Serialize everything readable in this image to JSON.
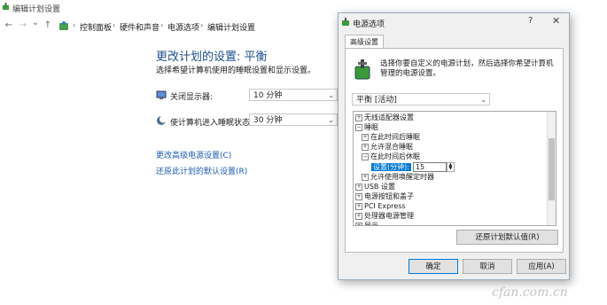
{
  "window": {
    "title": "编辑计划设置"
  },
  "address": {
    "nav": {
      "back": "←",
      "forward": "→",
      "recent": "⌄",
      "up": "↑"
    },
    "crumbs": [
      "控制面板",
      "硬件和声音",
      "电源选项",
      "编辑计划设置"
    ],
    "separator": "›"
  },
  "main": {
    "title": "更改计划的设置: 平衡",
    "subtitle": "选择希望计算机使用的睡眠设置和显示设置。",
    "rows": [
      {
        "label": "关闭显示器:",
        "value": "10 分钟"
      },
      {
        "label": "使计算机进入睡眠状态:",
        "value": "30 分钟"
      }
    ],
    "links": [
      "更改高级电源设置(C)",
      "还原此计划的默认设置(R)"
    ]
  },
  "dialog": {
    "title": "电源选项",
    "help": "?",
    "close": "✕",
    "tab": "高级设置",
    "description": "选择你要自定义的电源计划，然后选择你希望计算机管理的电源设置。",
    "plan": "平衡 [活动]",
    "tree": [
      {
        "expander": "+",
        "label": "无线适配器设置",
        "level": 0
      },
      {
        "expander": "−",
        "label": "睡眠",
        "level": 0
      },
      {
        "expander": "+",
        "label": "在此时间后睡眠",
        "level": 1
      },
      {
        "expander": "+",
        "label": "允许混合睡眠",
        "level": 1
      },
      {
        "expander": "−",
        "label": "在此时间后休眠",
        "level": 1
      },
      {
        "expander": "",
        "label": "",
        "level": 2
      },
      {
        "expander": "+",
        "label": "允许使用唤醒定时器",
        "level": 1
      },
      {
        "expander": "+",
        "label": "USB 设置",
        "level": 0
      },
      {
        "expander": "+",
        "label": "电源按钮和盖子",
        "level": 0
      },
      {
        "expander": "+",
        "label": "PCI Express",
        "level": 0
      },
      {
        "expander": "+",
        "label": "处理器电源管理",
        "level": 0
      },
      {
        "expander": "+",
        "label": "显示",
        "level": 0
      }
    ],
    "setting": {
      "label": "设置(分钟):",
      "value": "15"
    },
    "restore_button": "还原计划默认值(R)",
    "buttons": {
      "ok": "确定",
      "cancel": "取消",
      "apply": "应用(A)"
    }
  },
  "watermark": "cfan.com.cn",
  "colors": {
    "title": "#1e4e8c",
    "link": "#1a5fb4",
    "selection": "#0078d7"
  }
}
